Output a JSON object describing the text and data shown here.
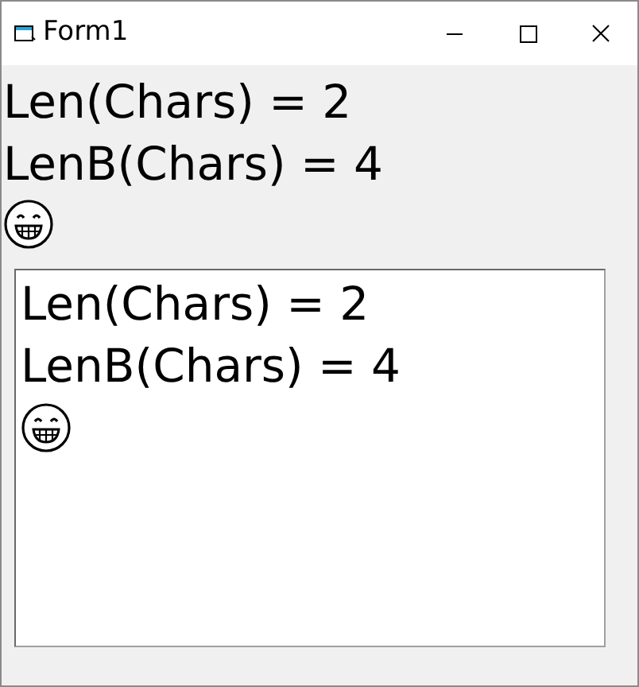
{
  "window": {
    "title": "Form1"
  },
  "labels": [
    "Len(Chars) = 2",
    "LenB(Chars) = 4"
  ],
  "textbox": {
    "lines": [
      "Len(Chars) = 2",
      "LenB(Chars) = 4"
    ]
  }
}
